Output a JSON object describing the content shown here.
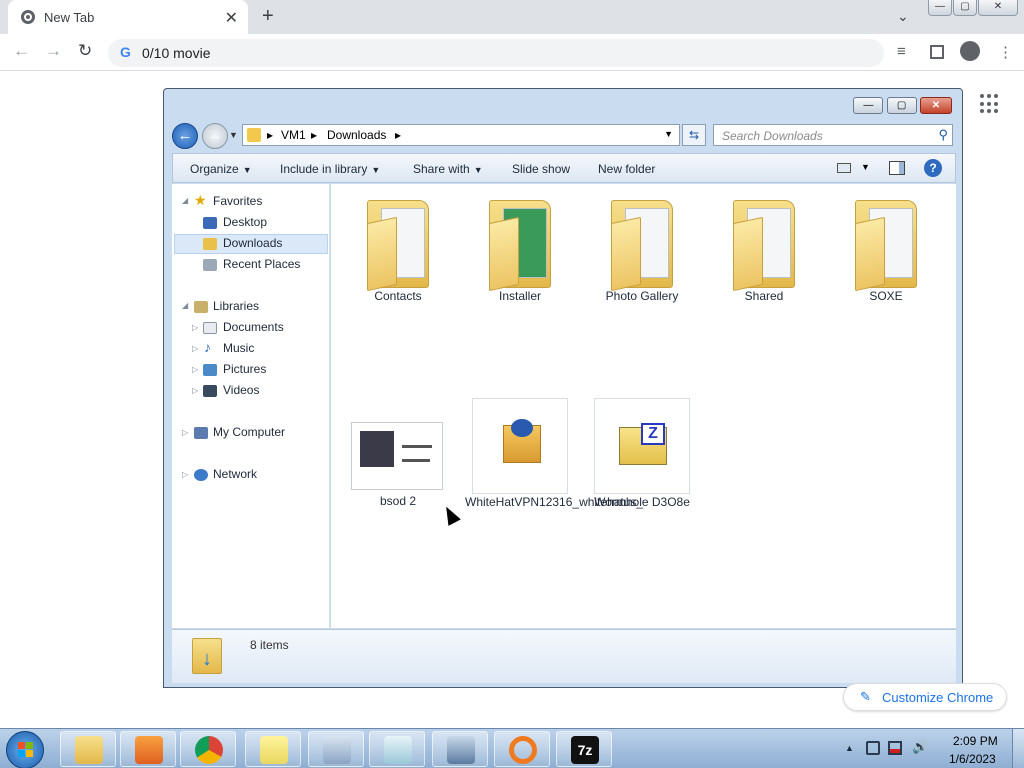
{
  "chrome": {
    "tab_title": "New Tab",
    "tab_close": "✕",
    "new_tab": "+",
    "tab_search": "⌄",
    "omnibox_text": "0/10 movie",
    "back": "←",
    "forward": "→",
    "reload": "↻",
    "customize_label": "Customize Chrome",
    "customize_icon": "✎",
    "win_min": "—",
    "win_max": "▢",
    "win_close": "✕"
  },
  "explorer": {
    "win_min": "—",
    "win_max": "▢",
    "win_close": "✕",
    "breadcrumb": [
      "VM1",
      "Downloads"
    ],
    "search_placeholder": "Search Downloads",
    "commands": [
      "Organize",
      "Include in library",
      "Share with",
      "Slide show",
      "New folder"
    ],
    "nav": {
      "favorites": "Favorites",
      "desktop": "Desktop",
      "downloads": "Downloads",
      "recent": "Recent Places",
      "libraries": "Libraries",
      "documents": "Documents",
      "music": "Music",
      "pictures": "Pictures",
      "videos": "Videos",
      "computer": "My Computer",
      "network": "Network"
    },
    "files": [
      {
        "label": "Contacts",
        "kind": "folder"
      },
      {
        "label": "Installer",
        "kind": "folder"
      },
      {
        "label": "Photo Gallery",
        "kind": "folder"
      },
      {
        "label": "Shared",
        "kind": "folder"
      },
      {
        "label": "SOXE",
        "kind": "folder"
      },
      {
        "label": "bsod 2",
        "kind": "image"
      },
      {
        "label": "WhiteHatVPN12316_whitehatus_",
        "kind": "installer"
      },
      {
        "label": "Wormhole D3O8e",
        "kind": "archive"
      }
    ],
    "item_count": "8 items",
    "help": "?"
  },
  "taskbar": {
    "time": "2:09 PM",
    "date": "1/6/2023",
    "apps": [
      "file-explorer-icon",
      "media-player-icon",
      "chrome-icon",
      "sticky-notes-icon",
      "calculator-icon",
      "notepad-icon",
      "network-connect-icon",
      "blender-icon",
      "7zip-icon"
    ]
  }
}
